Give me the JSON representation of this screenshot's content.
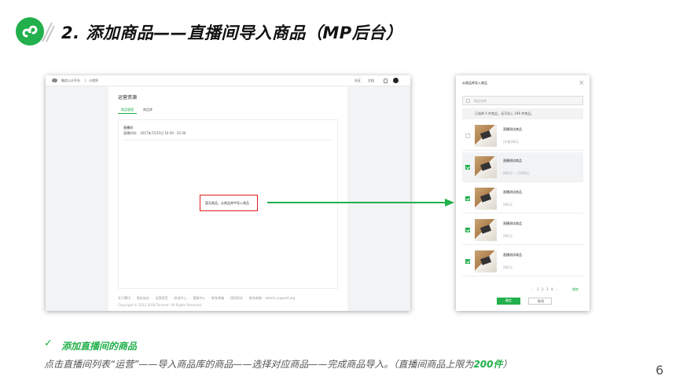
{
  "slide": {
    "title": "2. 添加商品——直播间导入商品（MP后台）",
    "subheading": "添加直播间的商品",
    "caption_main": "点击直播间列表“运营”——导入商品库的商品——选择对应商品——完成商品导入。（直播间商品上限为",
    "caption_limit": "200件",
    "caption_end": "）",
    "page_number": "6",
    "accent_color": "#21b04b",
    "highlight_color": "#e02020"
  },
  "left_screenshot": {
    "platform": "微信公众平台",
    "separator": "|",
    "section": "小程序",
    "top_links": [
      "社区",
      "文档"
    ],
    "page_title": "运营资源",
    "tabs": [
      "商品管理",
      "商品库"
    ],
    "room_label": "直播间",
    "live_time": "直播时间：  2017年7月15日 10:30 - 22:30",
    "empty_hint": "暂无商品，从商品库中导入商品",
    "footer_links": [
      "关于腾讯",
      "服务协议",
      "运营规范",
      "辟谣中心",
      "客服中心",
      "联系邮箱",
      "侵权投诉",
      "联系邮箱: weixin_support.org"
    ],
    "copyright": "Copyright © 2012-2018 Tencent. All Rights Reserved."
  },
  "right_screenshot": {
    "dialog_title": "从商品库导入商品",
    "search_placeholder": "商品名称",
    "selection_info": "已选择 4 件商品，还可导入 196 件商品。",
    "items": [
      {
        "name": "直播测试商品",
        "price": "[价格]88元",
        "checked": false,
        "highlighted": false
      },
      {
        "name": "直播测试商品",
        "price": "[88]元 — [198]元",
        "checked": true,
        "highlighted": true
      },
      {
        "name": "直播测试商品",
        "price": "[88]元",
        "checked": true,
        "highlighted": false
      },
      {
        "name": "直播测试商品",
        "price": "[88]元",
        "checked": true,
        "highlighted": false
      },
      {
        "name": "直播测试商品",
        "price": "[88]元",
        "checked": true,
        "highlighted": false
      }
    ],
    "pagination": [
      "‹",
      "1",
      "2",
      "3",
      "4",
      "›"
    ],
    "jump_label": "跳转",
    "confirm_label": "确定",
    "cancel_label": "取消"
  }
}
